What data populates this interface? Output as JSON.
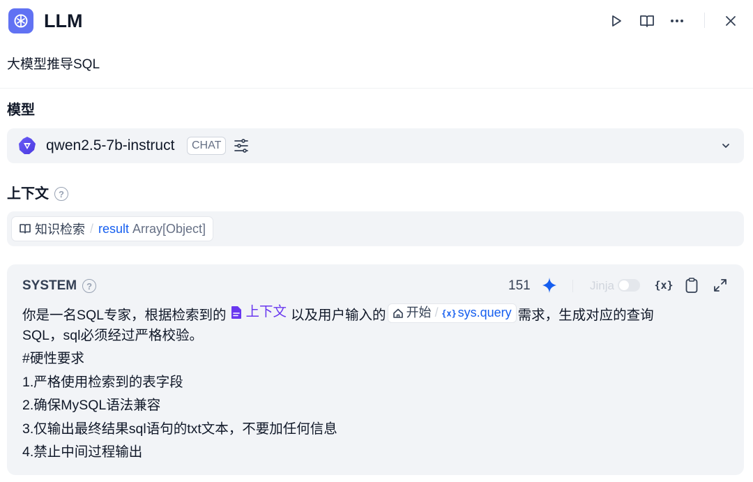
{
  "header": {
    "app_title": "LLM",
    "app_icon": "brain-icon",
    "accent_color": "#6172f3",
    "actions": [
      "run-icon",
      "docs-icon",
      "more-icon",
      "close-icon"
    ]
  },
  "description": "大模型推导SQL",
  "model": {
    "label": "模型",
    "name": "qwen2.5-7b-instruct",
    "mode_badge": "CHAT",
    "provider_icon": "qwen-logo-icon"
  },
  "context": {
    "label": "上下文",
    "variable": {
      "source": "知识检索",
      "name": "result",
      "type": "Array[Object]"
    }
  },
  "system": {
    "label": "SYSTEM",
    "token_count": "151",
    "jinja_label": "Jinja",
    "jinja_enabled": false,
    "prompt": {
      "line1_a": "你是一名SQL专家，根据检索到的",
      "context_tag": "上下文",
      "line1_b": "以及用户输入的",
      "var_node": "开始",
      "var_name": "sys.query",
      "line1_c": "需求，生成对应的查询",
      "lines": [
        "SQL，sql必须经过严格校验。",
        "#硬性要求",
        "1.严格使用检索到的表字段",
        "2.确保MySQL语法兼容",
        "3.仅输出最终结果sql语句的txt文本，不要加任何信息",
        "4.禁止中间过程输出"
      ]
    }
  }
}
